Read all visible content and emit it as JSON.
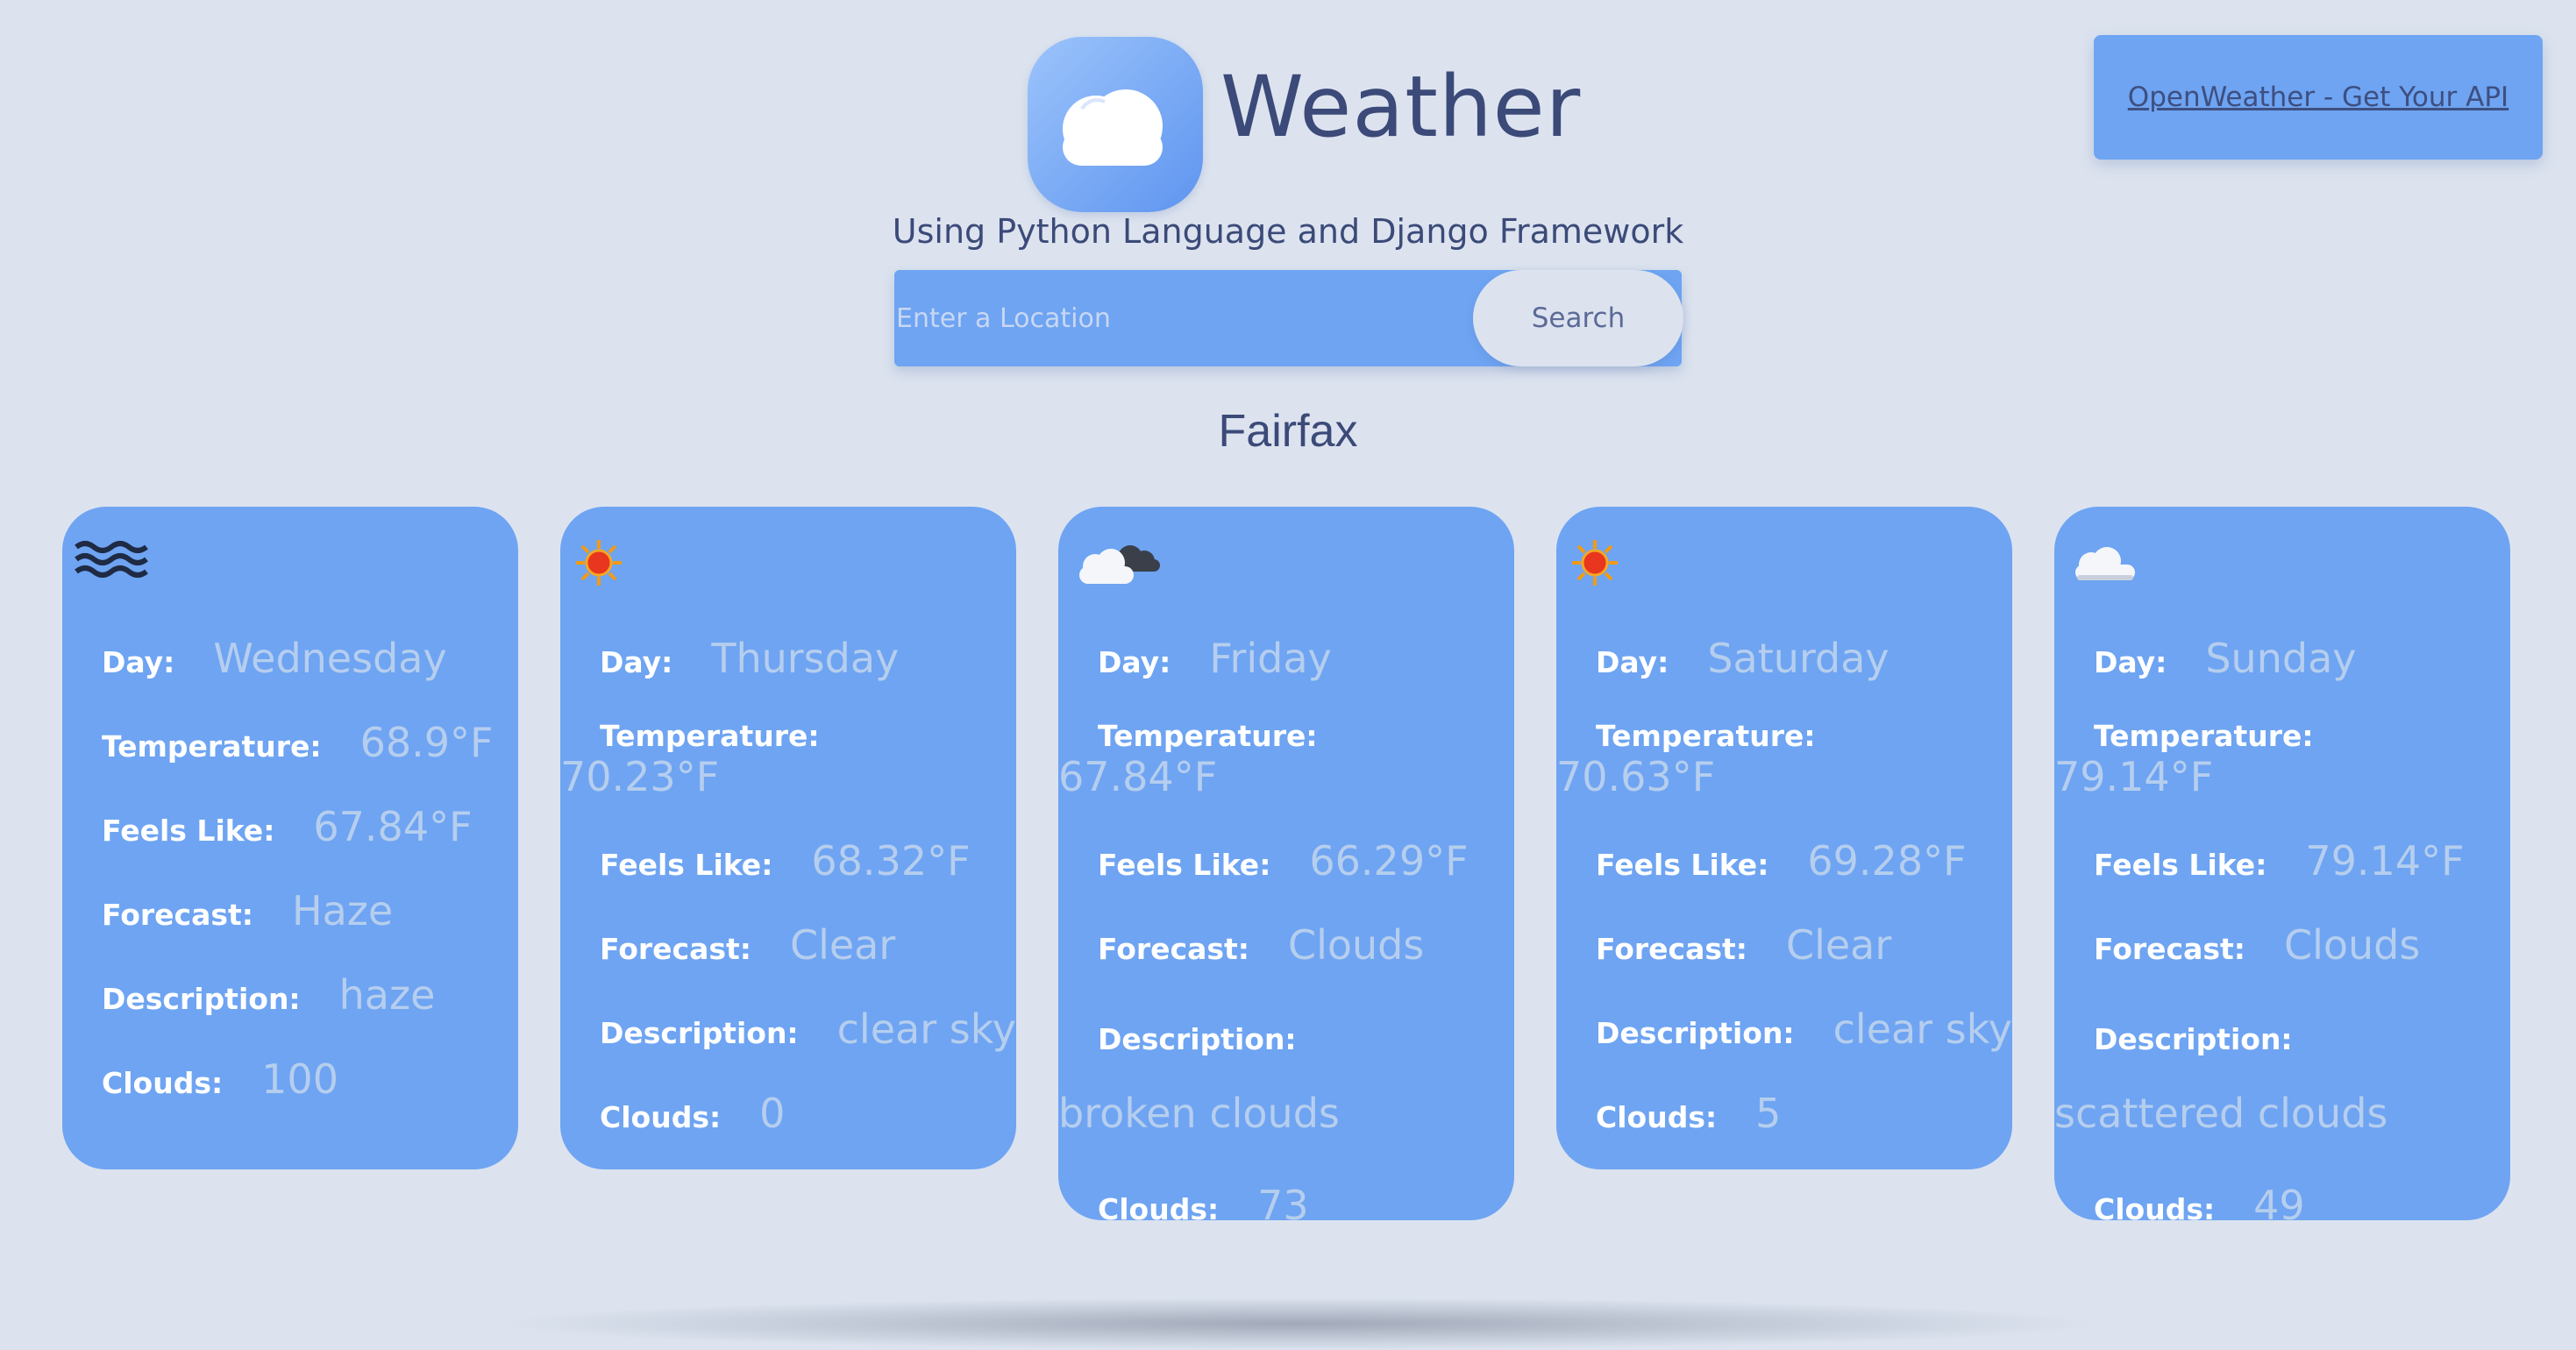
{
  "header": {
    "title": "Weather",
    "subtitle": "Using Python Language and Django Framework",
    "api_link": "OpenWeather - Get Your API",
    "logo_icon": "cloud-icon"
  },
  "search": {
    "placeholder": "Enter a Location",
    "value": "",
    "button_label": "Search"
  },
  "city": "Fairfax",
  "labels": {
    "day": "Day:",
    "temperature": "Temperature:",
    "feels_like": "Feels Like:",
    "forecast": "Forecast:",
    "description": "Description:",
    "clouds": "Clouds:"
  },
  "cards": [
    {
      "icon": "haze-icon",
      "day": "Wednesday",
      "temperature": "68.9°F",
      "feels_like": "67.84°F",
      "forecast": "Haze",
      "description": "haze",
      "clouds": "100"
    },
    {
      "icon": "sun-icon",
      "day": "Thursday",
      "temperature": "70.23°F",
      "feels_like": "68.32°F",
      "forecast": "Clear",
      "description": "clear sky",
      "clouds": "0"
    },
    {
      "icon": "broken-clouds-icon",
      "day": "Friday",
      "temperature": "67.84°F",
      "feels_like": "66.29°F",
      "forecast": "Clouds",
      "description": "broken clouds",
      "clouds": "73"
    },
    {
      "icon": "sun-icon",
      "day": "Saturday",
      "temperature": "70.63°F",
      "feels_like": "69.28°F",
      "forecast": "Clear",
      "description": "clear sky",
      "clouds": "5"
    },
    {
      "icon": "scattered-clouds-icon",
      "day": "Sunday",
      "temperature": "79.14°F",
      "feels_like": "79.14°F",
      "forecast": "Clouds",
      "description": "scattered clouds",
      "clouds": "49"
    }
  ],
  "colors": {
    "background": "#dce3ef",
    "card": "#6ea4f2",
    "label": "#ffffff",
    "value": "#b6ceee",
    "text": "#3b4a78"
  }
}
